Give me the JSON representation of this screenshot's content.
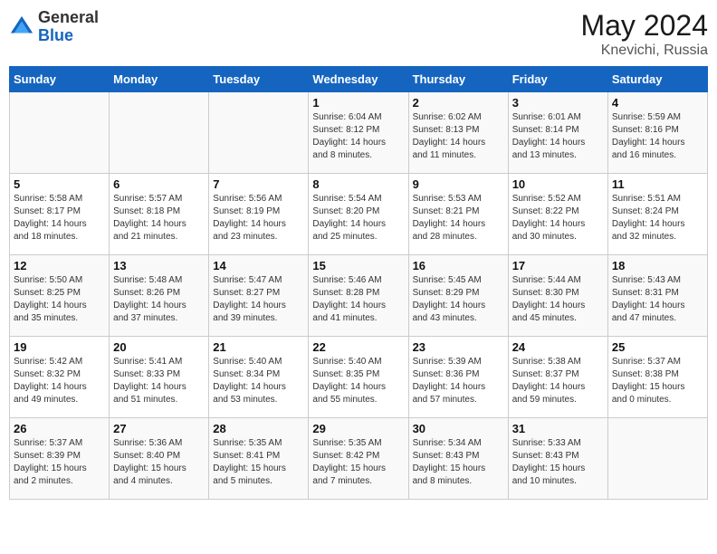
{
  "header": {
    "logo_general": "General",
    "logo_blue": "Blue",
    "month": "May 2024",
    "location": "Knevichi, Russia"
  },
  "days_of_week": [
    "Sunday",
    "Monday",
    "Tuesday",
    "Wednesday",
    "Thursday",
    "Friday",
    "Saturday"
  ],
  "weeks": [
    [
      {
        "num": "",
        "info": ""
      },
      {
        "num": "",
        "info": ""
      },
      {
        "num": "",
        "info": ""
      },
      {
        "num": "1",
        "info": "Sunrise: 6:04 AM\nSunset: 8:12 PM\nDaylight: 14 hours\nand 8 minutes."
      },
      {
        "num": "2",
        "info": "Sunrise: 6:02 AM\nSunset: 8:13 PM\nDaylight: 14 hours\nand 11 minutes."
      },
      {
        "num": "3",
        "info": "Sunrise: 6:01 AM\nSunset: 8:14 PM\nDaylight: 14 hours\nand 13 minutes."
      },
      {
        "num": "4",
        "info": "Sunrise: 5:59 AM\nSunset: 8:16 PM\nDaylight: 14 hours\nand 16 minutes."
      }
    ],
    [
      {
        "num": "5",
        "info": "Sunrise: 5:58 AM\nSunset: 8:17 PM\nDaylight: 14 hours\nand 18 minutes."
      },
      {
        "num": "6",
        "info": "Sunrise: 5:57 AM\nSunset: 8:18 PM\nDaylight: 14 hours\nand 21 minutes."
      },
      {
        "num": "7",
        "info": "Sunrise: 5:56 AM\nSunset: 8:19 PM\nDaylight: 14 hours\nand 23 minutes."
      },
      {
        "num": "8",
        "info": "Sunrise: 5:54 AM\nSunset: 8:20 PM\nDaylight: 14 hours\nand 25 minutes."
      },
      {
        "num": "9",
        "info": "Sunrise: 5:53 AM\nSunset: 8:21 PM\nDaylight: 14 hours\nand 28 minutes."
      },
      {
        "num": "10",
        "info": "Sunrise: 5:52 AM\nSunset: 8:22 PM\nDaylight: 14 hours\nand 30 minutes."
      },
      {
        "num": "11",
        "info": "Sunrise: 5:51 AM\nSunset: 8:24 PM\nDaylight: 14 hours\nand 32 minutes."
      }
    ],
    [
      {
        "num": "12",
        "info": "Sunrise: 5:50 AM\nSunset: 8:25 PM\nDaylight: 14 hours\nand 35 minutes."
      },
      {
        "num": "13",
        "info": "Sunrise: 5:48 AM\nSunset: 8:26 PM\nDaylight: 14 hours\nand 37 minutes."
      },
      {
        "num": "14",
        "info": "Sunrise: 5:47 AM\nSunset: 8:27 PM\nDaylight: 14 hours\nand 39 minutes."
      },
      {
        "num": "15",
        "info": "Sunrise: 5:46 AM\nSunset: 8:28 PM\nDaylight: 14 hours\nand 41 minutes."
      },
      {
        "num": "16",
        "info": "Sunrise: 5:45 AM\nSunset: 8:29 PM\nDaylight: 14 hours\nand 43 minutes."
      },
      {
        "num": "17",
        "info": "Sunrise: 5:44 AM\nSunset: 8:30 PM\nDaylight: 14 hours\nand 45 minutes."
      },
      {
        "num": "18",
        "info": "Sunrise: 5:43 AM\nSunset: 8:31 PM\nDaylight: 14 hours\nand 47 minutes."
      }
    ],
    [
      {
        "num": "19",
        "info": "Sunrise: 5:42 AM\nSunset: 8:32 PM\nDaylight: 14 hours\nand 49 minutes."
      },
      {
        "num": "20",
        "info": "Sunrise: 5:41 AM\nSunset: 8:33 PM\nDaylight: 14 hours\nand 51 minutes."
      },
      {
        "num": "21",
        "info": "Sunrise: 5:40 AM\nSunset: 8:34 PM\nDaylight: 14 hours\nand 53 minutes."
      },
      {
        "num": "22",
        "info": "Sunrise: 5:40 AM\nSunset: 8:35 PM\nDaylight: 14 hours\nand 55 minutes."
      },
      {
        "num": "23",
        "info": "Sunrise: 5:39 AM\nSunset: 8:36 PM\nDaylight: 14 hours\nand 57 minutes."
      },
      {
        "num": "24",
        "info": "Sunrise: 5:38 AM\nSunset: 8:37 PM\nDaylight: 14 hours\nand 59 minutes."
      },
      {
        "num": "25",
        "info": "Sunrise: 5:37 AM\nSunset: 8:38 PM\nDaylight: 15 hours\nand 0 minutes."
      }
    ],
    [
      {
        "num": "26",
        "info": "Sunrise: 5:37 AM\nSunset: 8:39 PM\nDaylight: 15 hours\nand 2 minutes."
      },
      {
        "num": "27",
        "info": "Sunrise: 5:36 AM\nSunset: 8:40 PM\nDaylight: 15 hours\nand 4 minutes."
      },
      {
        "num": "28",
        "info": "Sunrise: 5:35 AM\nSunset: 8:41 PM\nDaylight: 15 hours\nand 5 minutes."
      },
      {
        "num": "29",
        "info": "Sunrise: 5:35 AM\nSunset: 8:42 PM\nDaylight: 15 hours\nand 7 minutes."
      },
      {
        "num": "30",
        "info": "Sunrise: 5:34 AM\nSunset: 8:43 PM\nDaylight: 15 hours\nand 8 minutes."
      },
      {
        "num": "31",
        "info": "Sunrise: 5:33 AM\nSunset: 8:43 PM\nDaylight: 15 hours\nand 10 minutes."
      },
      {
        "num": "",
        "info": ""
      }
    ]
  ]
}
